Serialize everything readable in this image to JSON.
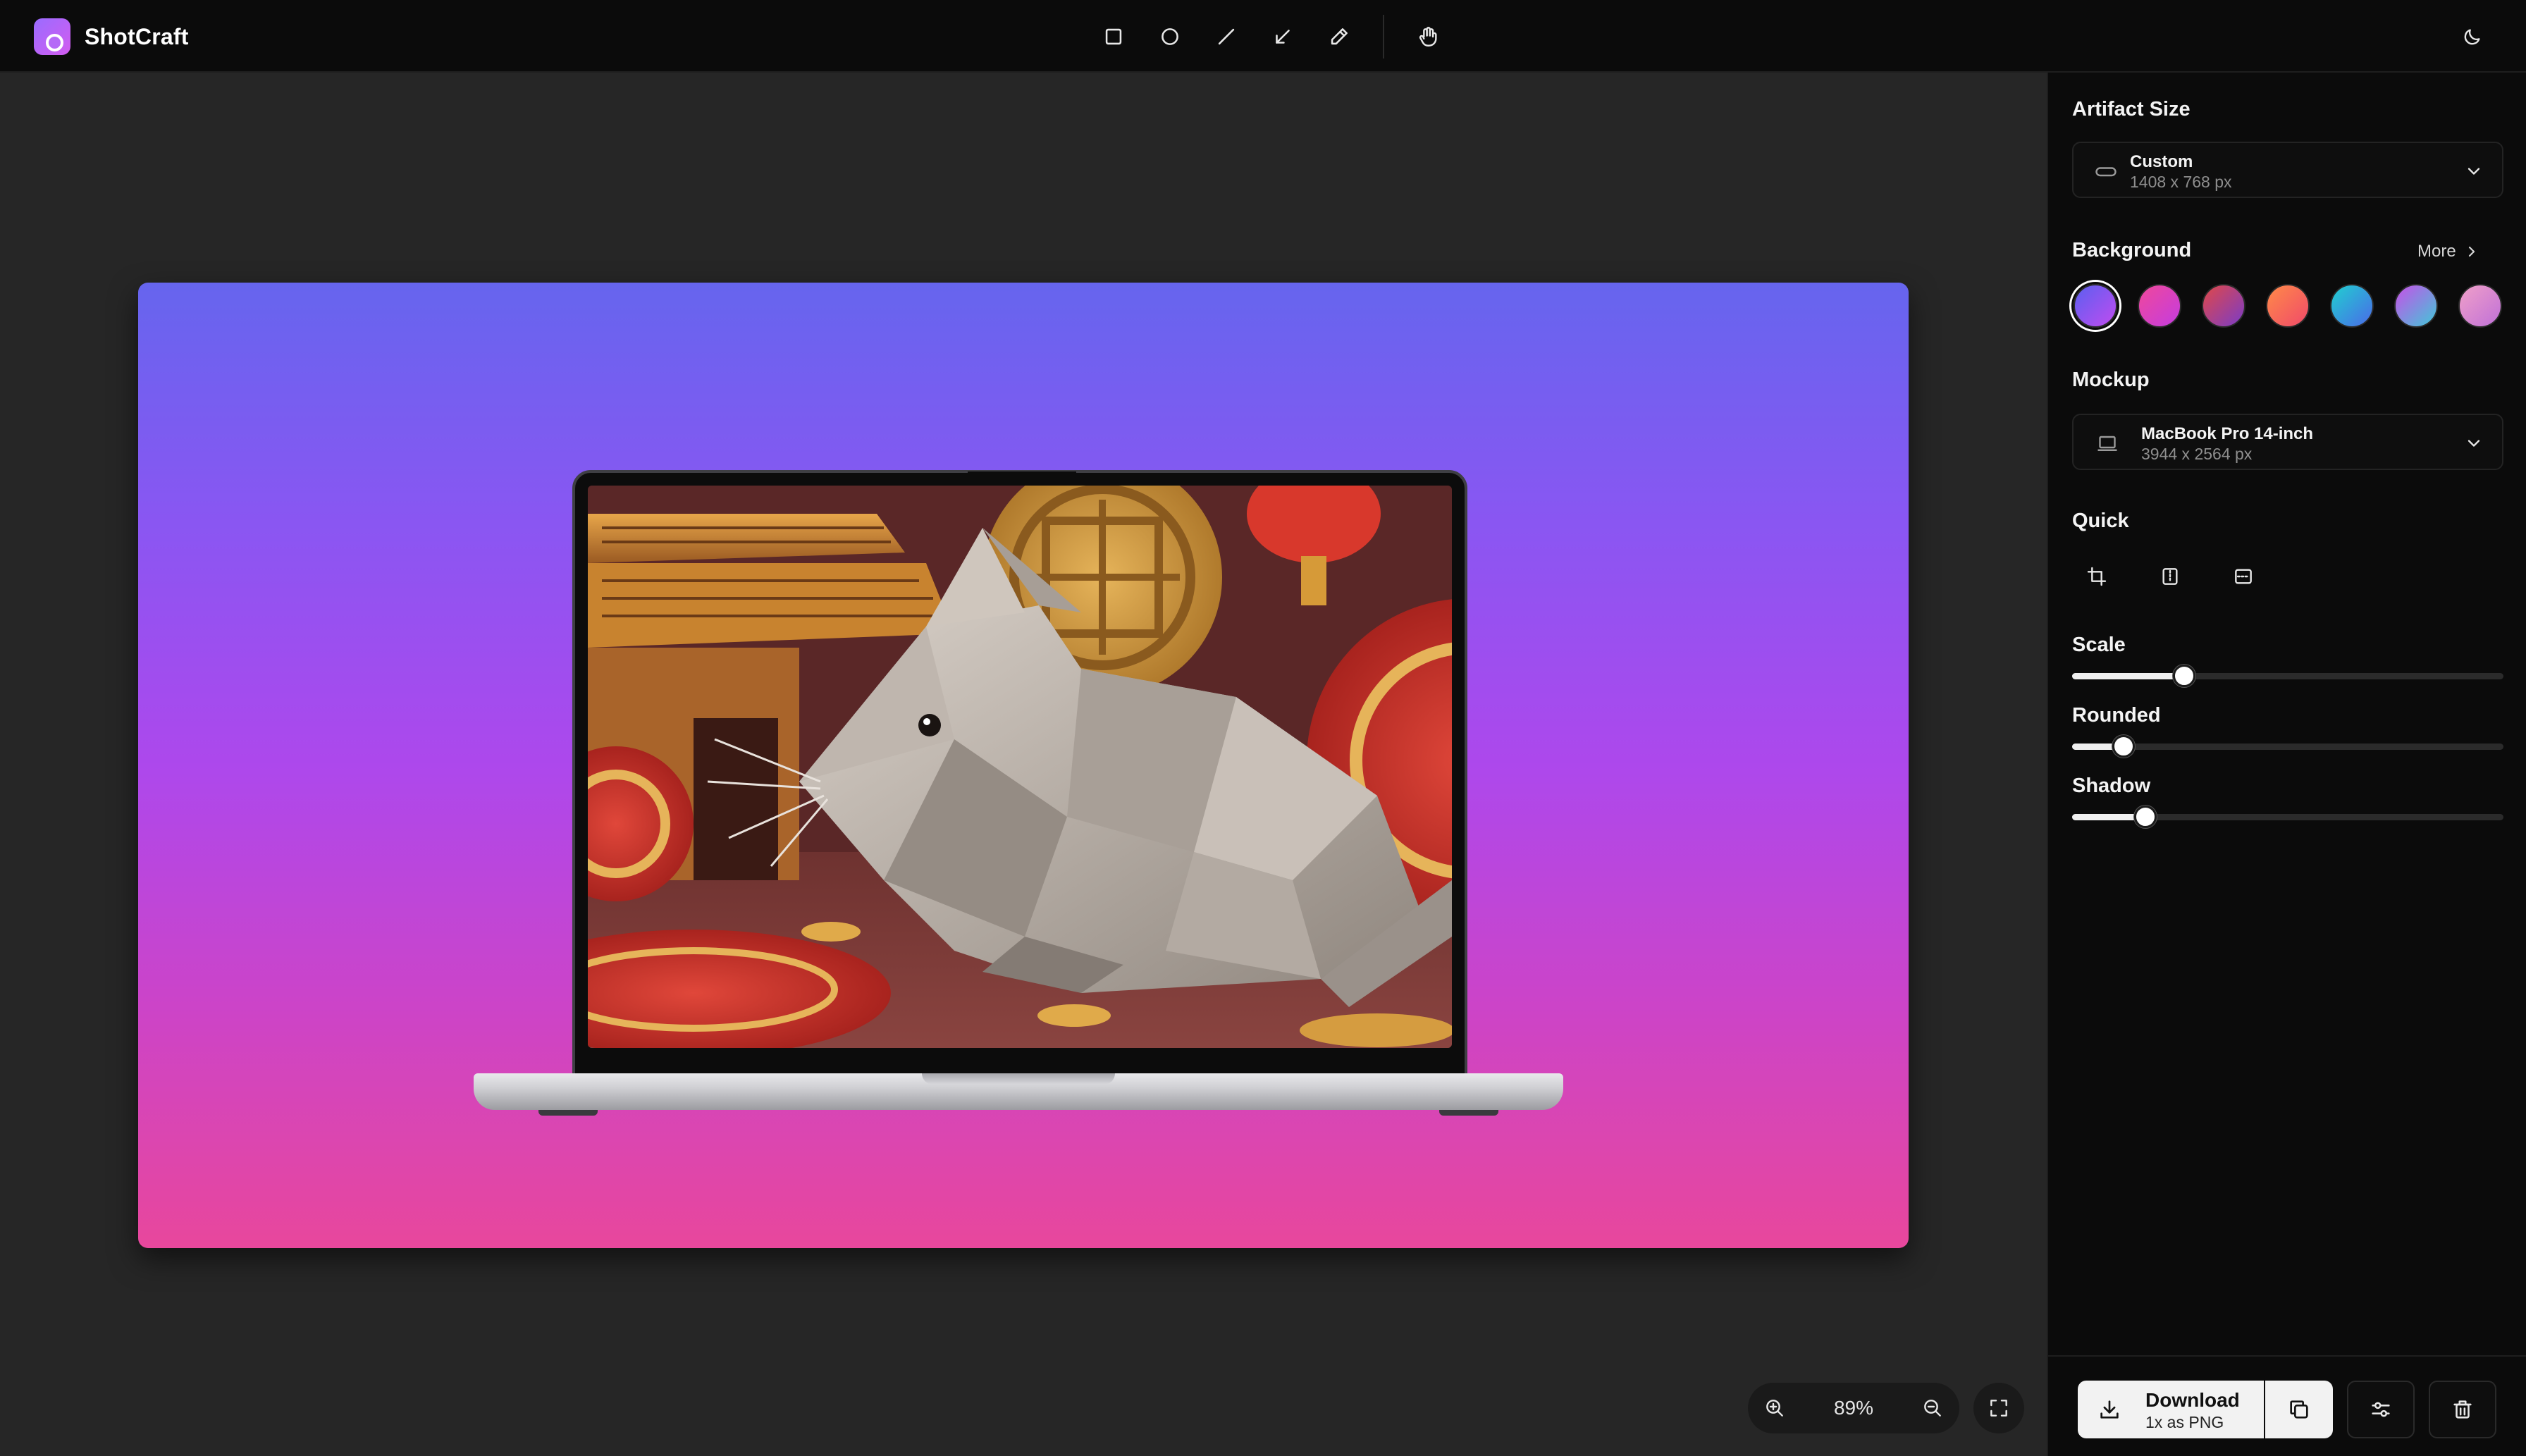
{
  "app": {
    "name": "ShotCraft"
  },
  "toolbar": {
    "tools": [
      {
        "name": "rectangle-tool",
        "icon": "square-icon"
      },
      {
        "name": "ellipse-tool",
        "icon": "circle-icon"
      },
      {
        "name": "line-tool",
        "icon": "line-icon"
      },
      {
        "name": "arrow-tool",
        "icon": "arrow-icon"
      },
      {
        "name": "pen-tool",
        "icon": "pencil-icon"
      },
      {
        "name": "pan-tool",
        "icon": "hand-icon"
      }
    ],
    "theme_icon": "moon-icon"
  },
  "canvas": {
    "background_gradient": [
      "#6665ee",
      "#8a56f2",
      "#ad48ec",
      "#cc44c8",
      "#e8479c"
    ],
    "zoom": "89%"
  },
  "panel": {
    "artifact_size": {
      "title": "Artifact Size",
      "value": "Custom",
      "detail": "1408 x 768 px"
    },
    "background": {
      "title": "Background",
      "more_label": "More",
      "swatches": [
        {
          "name": "violet",
          "colors": [
            "#5b5ff0",
            "#c04cf0"
          ],
          "selected": true
        },
        {
          "name": "pink",
          "colors": [
            "#f0489a",
            "#c43ce0"
          ],
          "selected": false
        },
        {
          "name": "plum",
          "colors": [
            "#e04848",
            "#7a3cc8"
          ],
          "selected": false
        },
        {
          "name": "coral",
          "colors": [
            "#ff8a48",
            "#f04a6a"
          ],
          "selected": false
        },
        {
          "name": "teal",
          "colors": [
            "#20d0d0",
            "#4a6ae8"
          ],
          "selected": false
        },
        {
          "name": "iris",
          "colors": [
            "#c850e8",
            "#40c8d8"
          ],
          "selected": false
        },
        {
          "name": "rose",
          "colors": [
            "#f0a0c8",
            "#c070d8"
          ],
          "selected": false
        }
      ]
    },
    "mockup": {
      "title": "Mockup",
      "value": "MacBook Pro 14-inch",
      "detail": "3944 x 2564 px"
    },
    "quick": {
      "title": "Quick",
      "actions": [
        "crop-icon",
        "split-vertical-icon",
        "split-horizontal-icon"
      ]
    },
    "scale": {
      "title": "Scale",
      "value": 0.26
    },
    "rounded": {
      "title": "Rounded",
      "value": 0.12
    },
    "shadow": {
      "title": "Shadow",
      "value": 0.17
    },
    "footer": {
      "download_label": "Download",
      "download_detail": "1x as PNG"
    }
  }
}
